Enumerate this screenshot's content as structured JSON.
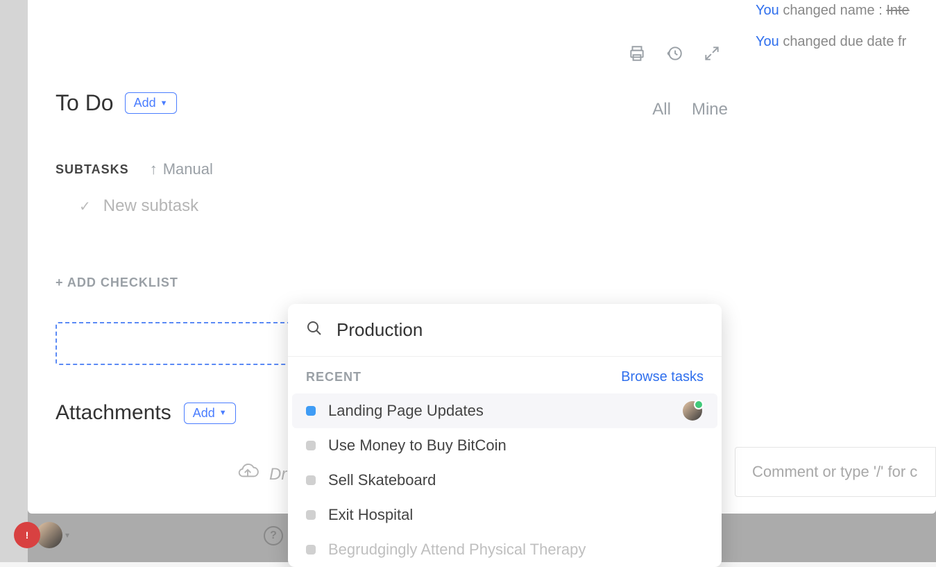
{
  "section": {
    "title": "To Do",
    "add_label": "Add"
  },
  "subtasks": {
    "label": "SUBTASKS",
    "sort_label": "Manual",
    "new_placeholder": "New subtask"
  },
  "checklist": {
    "add_label": "+ ADD CHECKLIST"
  },
  "attachments": {
    "title": "Attachments",
    "add_label": "Add",
    "dropzone_hint": "Dr"
  },
  "filters": {
    "all": "All",
    "mine": "Mine"
  },
  "activity": [
    {
      "actor": "You",
      "text": "changed name :",
      "struck": "Inte"
    },
    {
      "actor": "You",
      "text": "changed due date fr",
      "struck": ""
    }
  ],
  "comment": {
    "placeholder": "Comment or type '/' for c"
  },
  "search": {
    "value": "Production",
    "recent_label": "RECENT",
    "browse_label": "Browse tasks",
    "items": [
      {
        "label": "Landing Page Updates",
        "status": "blue",
        "avatar": true,
        "highlighted": true
      },
      {
        "label": "Use Money to Buy BitCoin",
        "status": "grey"
      },
      {
        "label": "Sell Skateboard",
        "status": "grey"
      },
      {
        "label": "Exit Hospital",
        "status": "grey"
      },
      {
        "label": "Begrudgingly Attend Physical Therapy",
        "status": "grey",
        "faded": true
      }
    ]
  },
  "bottom_badge": "!"
}
